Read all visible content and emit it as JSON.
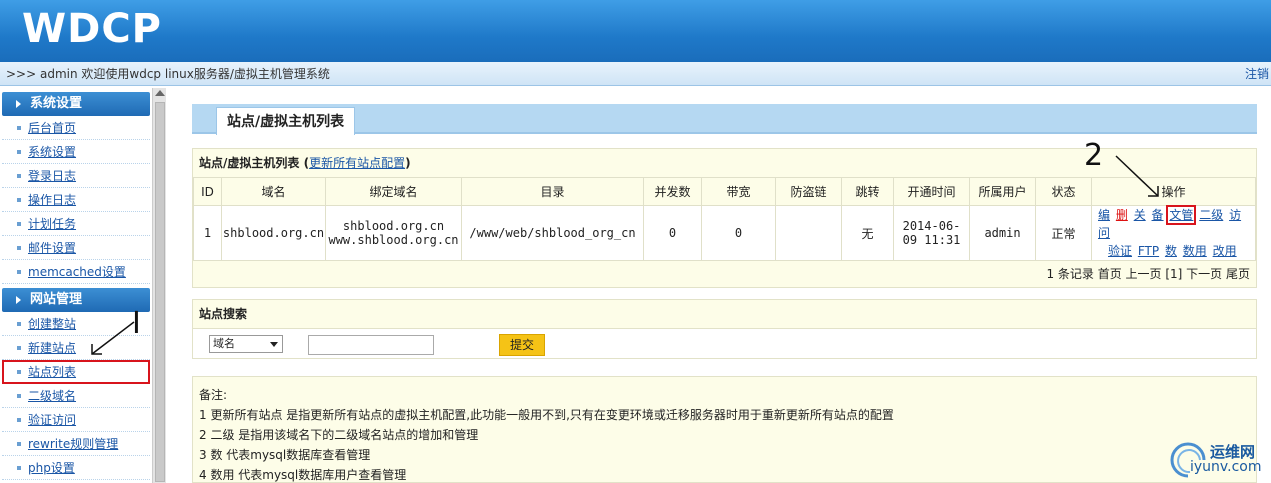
{
  "header": {
    "logo": "WDCP"
  },
  "welcome": {
    "text": ">>> admin 欢迎使用wdcp linux服务器/虚拟主机管理系统",
    "logout": "注销"
  },
  "sidebar": {
    "groups": [
      {
        "title": "系统设置",
        "items": [
          "后台首页",
          "系统设置",
          "登录日志",
          "操作日志",
          "计划任务",
          "邮件设置",
          "memcached设置"
        ]
      },
      {
        "title": "网站管理",
        "items": [
          "创建整站",
          "新建站点",
          "站点列表",
          "二级域名",
          "验证访问",
          "rewrite规则管理",
          "php设置"
        ]
      }
    ]
  },
  "tab": {
    "title": "站点/虚拟主机列表"
  },
  "list": {
    "title": "站点/虚拟主机列表",
    "update_link": "更新所有站点配置",
    "columns": [
      "ID",
      "域名",
      "绑定域名",
      "目录",
      "并发数",
      "带宽",
      "防盗链",
      "跳转",
      "开通时间",
      "所属用户",
      "状态",
      "操作"
    ],
    "row": {
      "id": "1",
      "domain": "shblood.org.cn",
      "bind1": "shblood.org.cn",
      "bind2": "www.shblood.org.cn",
      "dir": "/www/web/shblood_org_cn",
      "conn": "0",
      "bandwidth": "0",
      "antileech": "",
      "redirect": "无",
      "time1": "2014-06-",
      "time2": "09 11:31",
      "user": "admin",
      "status": "正常",
      "ops_line1": [
        "编",
        "删",
        "关",
        "备",
        "文管",
        "二级",
        "访问"
      ],
      "ops_line2": [
        "验证",
        "FTP",
        "数",
        "数用",
        "改用"
      ]
    },
    "pager": "1 条记录 首页 上一页 [1] 下一页 尾页"
  },
  "search": {
    "title": "站点搜索",
    "select_value": "域名",
    "input_value": "",
    "submit": "提交"
  },
  "notes": {
    "lines": [
      "备注:",
      "1 更新所有站点 是指更新所有站点的虚拟主机配置,此功能一般用不到,只有在变更环境或迁移服务器时用于重新更新所有站点的配置",
      "2 二级 是指用该域名下的二级域名站点的增加和管理",
      "3 数 代表mysql数据库查看管理",
      "4 数用 代表mysql数据库用户查看管理"
    ]
  },
  "annotations": {
    "one": "I",
    "two": "2"
  },
  "watermark": {
    "line1": "运维网",
    "line2": "iyunv.com"
  },
  "colors": {
    "header": "#1f79c9",
    "highlight": "#d8141c",
    "link": "#1a56a6",
    "panel": "#fdfde8"
  }
}
